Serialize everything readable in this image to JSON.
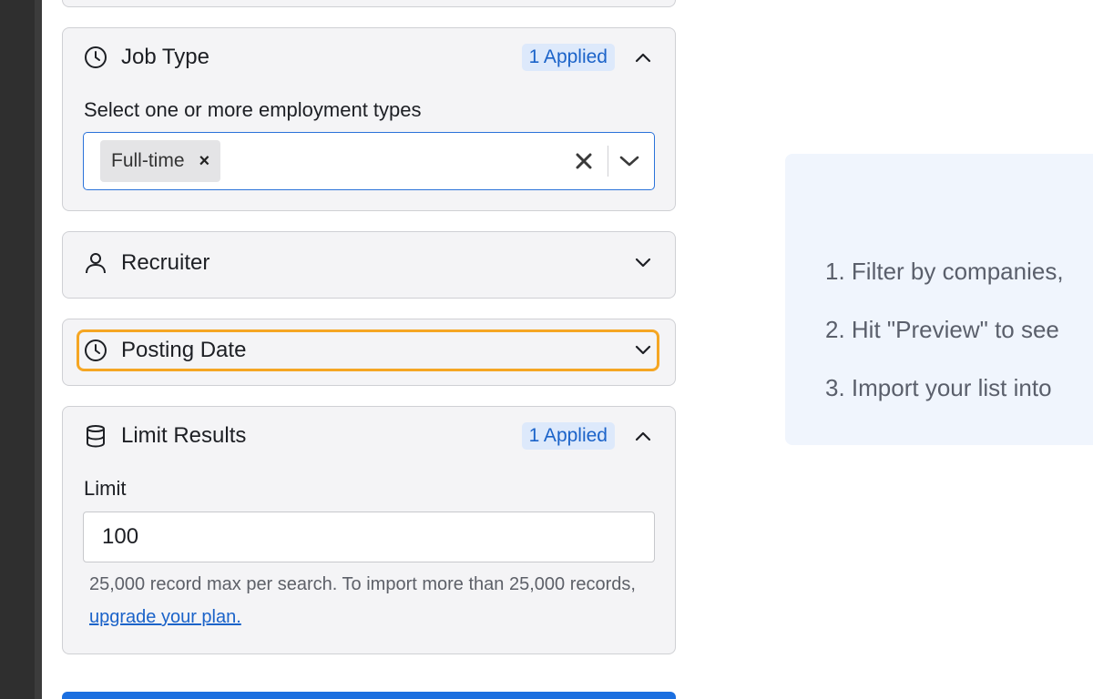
{
  "filters": {
    "job_type": {
      "title": "Job Type",
      "badge": "1 Applied",
      "label": "Select one or more employment types",
      "selected_chip": "Full-time",
      "chip_remove": "×"
    },
    "recruiter": {
      "title": "Recruiter"
    },
    "posting_date": {
      "title": "Posting Date"
    },
    "limit_results": {
      "title": "Limit Results",
      "badge": "1 Applied",
      "label": "Limit",
      "value": "100",
      "help_text": "25,000 record max per search. To import more than 25,000 records, ",
      "help_link": "upgrade your plan."
    }
  },
  "steps": [
    "1. Filter by companies,",
    "2. Hit \"Preview\" to see",
    "3. Import your list into"
  ],
  "colors": {
    "accent": "#2a72d9",
    "badge_bg": "#dde9fb",
    "badge_text": "#1b63c9",
    "focus": "#f5a623",
    "card_bg": "#f4f4f6",
    "info_bg": "#f0f5fd"
  },
  "icons": {
    "job_type": "clock-icon",
    "recruiter": "person-icon",
    "posting_date": "clock-icon",
    "limit_results": "database-icon"
  }
}
